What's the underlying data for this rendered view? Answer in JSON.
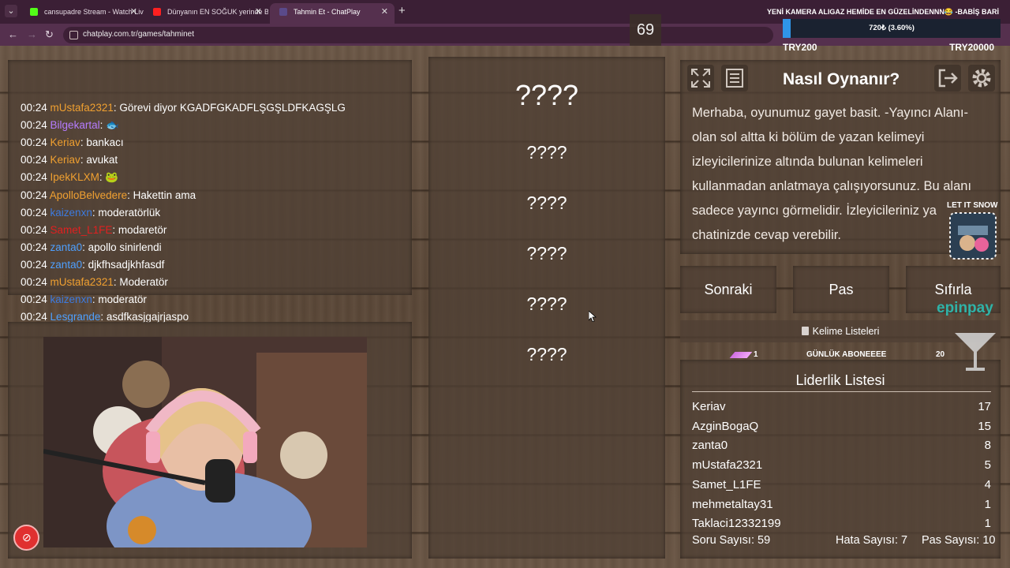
{
  "browser": {
    "tabs": [
      {
        "title": "cansupadre Stream - Watch Live",
        "favicon_color": "#53fc18"
      },
      {
        "title": "Dünyanın EN SOĞUK yerinde B",
        "favicon_color": "#ff2020"
      },
      {
        "title": "Tahmin Et - ChatPlay",
        "favicon_color": "#5a4a8a"
      }
    ],
    "url": "chatplay.com.tr/games/tahminet"
  },
  "chat": {
    "messages": [
      {
        "time": "00:24",
        "user": "mUstafa2321",
        "color": "#f0a030",
        "text": "Görevi diyor KGADFGKADFLŞGŞLDFKAGŞLG"
      },
      {
        "time": "00:24",
        "user": "Bilgekartal",
        "color": "#b57cff",
        "text": "🐟"
      },
      {
        "time": "00:24",
        "user": "Keriav",
        "color": "#f0a030",
        "text": "bankacı"
      },
      {
        "time": "00:24",
        "user": "Keriav",
        "color": "#f0a030",
        "text": "avukat"
      },
      {
        "time": "00:24",
        "user": "IpekKLXM",
        "color": "#f0a030",
        "text": "🐸"
      },
      {
        "time": "00:24",
        "user": "ApolloBelvedere",
        "color": "#f0a030",
        "text": "Hakettin ama"
      },
      {
        "time": "00:24",
        "user": "kaizenxn",
        "color": "#3d7be0",
        "text": "moderatörlük"
      },
      {
        "time": "00:24",
        "user": "Samet_L1FE",
        "color": "#e02020",
        "text": "modaretör"
      },
      {
        "time": "00:24",
        "user": "zanta0",
        "color": "#4ea0ff",
        "text": "apollo sinirlendi"
      },
      {
        "time": "00:24",
        "user": "zanta0",
        "color": "#4ea0ff",
        "text": "djkfhsadjkhfasdf"
      },
      {
        "time": "00:24",
        "user": "mUstafa2321",
        "color": "#f0a030",
        "text": "Moderatör"
      },
      {
        "time": "00:24",
        "user": "kaizenxn",
        "color": "#3d7be0",
        "text": "moderatör"
      },
      {
        "time": "00:24",
        "user": "Lesgrande",
        "color": "#4ea0ff",
        "text": "asdfkasjgajrjaspo"
      }
    ]
  },
  "game": {
    "counter": "69",
    "main_word": "????",
    "words": [
      "????",
      "????",
      "????",
      "????",
      "????"
    ]
  },
  "howto": {
    "title": "Nasıl Oynanır?",
    "text": "Merhaba, oyunumuz gayet basit. -Yayıncı Alanı- olan sol altta ki bölüm de yazan kelimeyi izleyicilerinize altında bulunan kelimeleri kullanmadan anlatmaya çalışıyorsunuz. Bu alanı sadece yayıncı görmelidir. İzleyicileriniz ya chatinizde cevap verebilir.",
    "icons": [
      "fullscreen-icon",
      "list-icon",
      "exit-icon",
      "gear-icon"
    ]
  },
  "buttons": {
    "next": "Sonraki",
    "pass": "Pas",
    "reset": "Sıfırla"
  },
  "word_lists": "Kelime Listeleri",
  "sub_goal": {
    "current": "1",
    "label": "GÜNLÜK ABONEEEE",
    "target": "20"
  },
  "leaderboard": {
    "title": "Liderlik Listesi",
    "rows": [
      {
        "name": "Keriav",
        "score": "17"
      },
      {
        "name": "AzginBogaQ",
        "score": "15"
      },
      {
        "name": "zanta0",
        "score": "8"
      },
      {
        "name": "mUstafa2321",
        "score": "5"
      },
      {
        "name": "Samet_L1FE",
        "score": "4"
      },
      {
        "name": "mehmetaltay31",
        "score": "1"
      },
      {
        "name": "Taklaci12332199",
        "score": "1"
      }
    ]
  },
  "stats": {
    "questions": "Soru Sayısı: 59",
    "errors": "Hata Sayısı: 7",
    "passes": "Pas Sayısı: 10"
  },
  "overlay": {
    "title": "YENİ KAMERA ALIGAZ HEMİDE EN GÜZELİNDENNN😂 -BABİŞ BARİ",
    "progress_text": "720₺ (3.60%)",
    "progress": 0.036,
    "min": "TRY200",
    "max": "TRY20000",
    "snow_label": "LET IT SNOW",
    "epin": "epinpay"
  }
}
